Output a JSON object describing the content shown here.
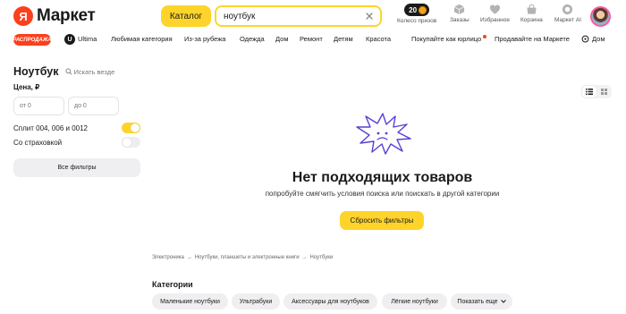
{
  "header": {
    "logo_badge": "Я",
    "logo_word": "Маркет",
    "catalog_label": "Каталог",
    "search_value": "ноутбук",
    "wheel_count": "20",
    "wheel_label": "Колесо призов",
    "orders_label": "Заказы",
    "favorites_label": "Избранное",
    "cart_label": "Корзина",
    "ai_label": "Маркет AI"
  },
  "nav": {
    "sale_label": "РАСПРОДАЖА",
    "ultima_icon_letter": "U",
    "ultima_label": "Ultima",
    "items": [
      "Любимая категория",
      "Из-за рубежа",
      "Одежда",
      "Дом",
      "Ремонт",
      "Детям",
      "Красота"
    ],
    "business_label": "Покупайте как юрлицо",
    "sell_label": "Продавайте на Маркете",
    "location_label": "Дом"
  },
  "filters": {
    "title": "Ноутбук",
    "search_everywhere": "Искать везде",
    "price_label": "Цена, ₽",
    "price_from_placeholder": "от 0",
    "price_to_placeholder": "до 0",
    "split_label": "Сплит 004, 006 и 0012",
    "split_on": true,
    "insurance_label": "Со страховкой",
    "insurance_on": false,
    "all_filters_label": "Все фильтры"
  },
  "empty_state": {
    "title": "Нет подходящих товаров",
    "subtitle": "попробуйте смягчить условия поиска или поискать в другой категории",
    "reset_label": "Сбросить фильтры"
  },
  "breadcrumb": [
    "Электроника",
    "Ноутбуки, планшеты и электронные книги",
    "Ноутбуки"
  ],
  "breadcrumb_separator": "→",
  "categories": {
    "title": "Категории",
    "chips": [
      "Маленькие ноутбуки",
      "Ультрабуки",
      "Аксессуары для ноутбуков",
      "Лёгкие ноутбуки"
    ],
    "show_more": "Показать еще"
  },
  "colors": {
    "accent_yellow": "#fed42b",
    "brand_red": "#fc3f1d",
    "illustration_purple": "#5b3fd6"
  }
}
